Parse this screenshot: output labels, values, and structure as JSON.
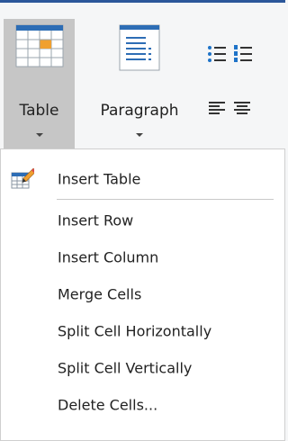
{
  "ribbon": {
    "table_label": "Table",
    "paragraph_label": "Paragraph"
  },
  "menu": {
    "items": [
      {
        "label": "Insert Table",
        "icon": "insert-table-icon"
      },
      {
        "label": "Insert Row"
      },
      {
        "label": "Insert Column"
      },
      {
        "label": "Merge Cells"
      },
      {
        "label": "Split Cell Horizontally"
      },
      {
        "label": "Split Cell Vertically"
      },
      {
        "label": "Delete Cells..."
      }
    ]
  },
  "colors": {
    "accent": "#2b579a",
    "selected_button_bg": "#c6c6c6",
    "icon_blue": "#1e73c8",
    "icon_orange": "#f0a030"
  }
}
